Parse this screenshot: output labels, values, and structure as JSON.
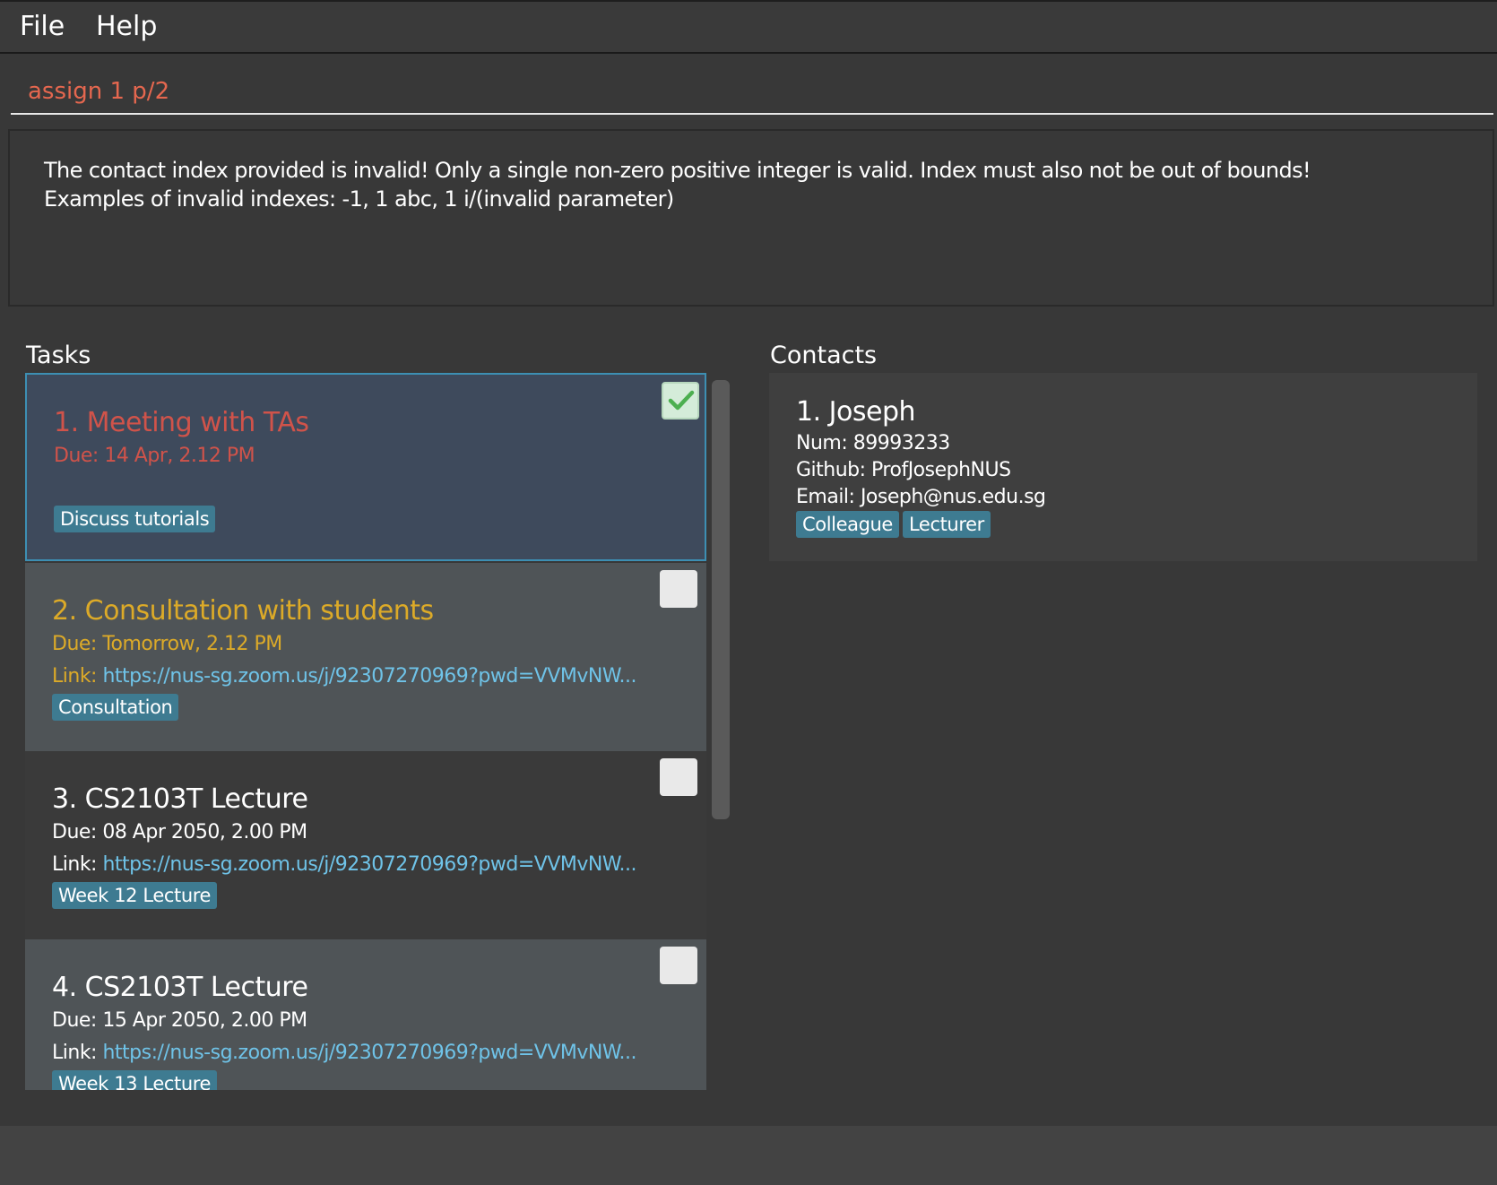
{
  "menu": {
    "file": "File",
    "help": "Help"
  },
  "command": {
    "value": "assign 1 p/2"
  },
  "result": {
    "line1": "The contact index provided is invalid! Only a single non-zero positive integer is valid. Index must also not be out of bounds!",
    "line2": "Examples of invalid indexes: -1, 1 abc, 1 i/(invalid parameter)"
  },
  "tasks": {
    "title": "Tasks",
    "items": [
      {
        "title": "1.  Meeting with TAs",
        "due": "Due: 14 Apr, 2.12 PM",
        "link_label": "",
        "link": "",
        "tag": "Discuss tutorials",
        "done": true,
        "color": "#d0534a"
      },
      {
        "title": "2.  Consultation with students",
        "due": "Due: Tomorrow, 2.12 PM",
        "link_label": "Link: ",
        "link": "https://nus-sg.zoom.us/j/92307270969?pwd=VVMvNW...",
        "tag": "Consultation",
        "done": false,
        "color": "#dcaa28"
      },
      {
        "title": "3.  CS2103T Lecture",
        "due": "Due: 08 Apr 2050, 2.00 PM",
        "link_label": "Link: ",
        "link": "https://nus-sg.zoom.us/j/92307270969?pwd=VVMvNW...",
        "tag": "Week 12 Lecture",
        "done": false,
        "color": "#ffffff"
      },
      {
        "title": "4.  CS2103T Lecture",
        "due": "Due: 15 Apr 2050, 2.00 PM",
        "link_label": "Link: ",
        "link": "https://nus-sg.zoom.us/j/92307270969?pwd=VVMvNW...",
        "tag": "Week 13 Lecture",
        "done": false,
        "color": "#ffffff"
      }
    ]
  },
  "contacts": {
    "title": "Contacts",
    "items": [
      {
        "name": "1.  Joseph",
        "num": "Num: 89993233",
        "github": "Github: ProfJosephNUS",
        "email": "Email: Joseph@nus.edu.sg",
        "tags": [
          "Colleague",
          "Lecturer"
        ]
      }
    ]
  },
  "colors": {
    "background": "#383838",
    "command_text": "#e5674f",
    "overdue": "#d0534a",
    "due_soon": "#dcaa28",
    "link": "#6fc3e8",
    "tag": "#3e7b91",
    "selected_border": "#3d8fb3",
    "checkmark": "#4caf50"
  },
  "icons": {
    "done": "checkmark-icon"
  }
}
